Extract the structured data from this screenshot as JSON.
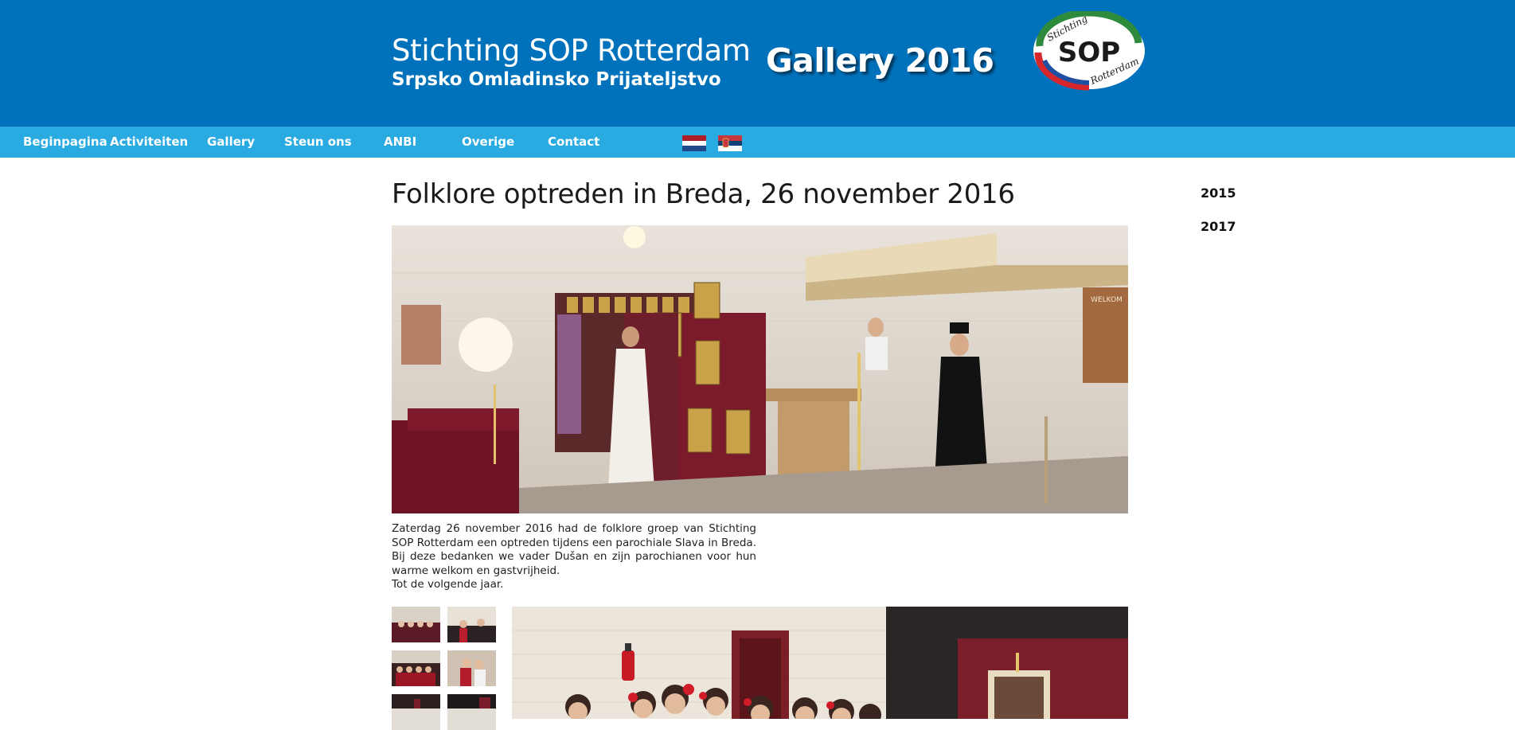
{
  "header": {
    "site_title": "Stichting SOP Rotterdam",
    "site_subtitle": "Srpsko Omladinsko Prijateljstvo",
    "gallery_title": "Gallery 2016",
    "logo_top_text": "Stichting",
    "logo_main_text": "SOP",
    "logo_bottom_text": "Rotterdam"
  },
  "nav": {
    "items": [
      "Beginpagina",
      "Activiteiten",
      "Gallery",
      "Steun ons",
      "ANBI",
      "Overige",
      "Contact"
    ],
    "flags": [
      "dutch-flag-icon",
      "serbian-flag-icon"
    ]
  },
  "main": {
    "heading": "Folklore optreden in Breda, 26 november 2016",
    "caption_paragraph": "Zaterdag 26 november 2016 had de folklore groep van Stichting SOP Rotterdam een optreden tijdens een parochiale Slava in Breda. Bij deze bedanken we vader Dušan en zijn parochianen voor hun warme welkom en gastvrijheid.",
    "caption_closing": "Tot de volgende jaar.",
    "photo_sign_text": "WELKOM"
  },
  "sidebar": {
    "years": [
      "2015",
      "2017"
    ]
  },
  "colors": {
    "header_blue": "#0072bc",
    "nav_blue": "#29abe2",
    "logo_green": "#2e8b3e",
    "logo_red": "#d7262c",
    "logo_blue": "#1f4fa3"
  }
}
